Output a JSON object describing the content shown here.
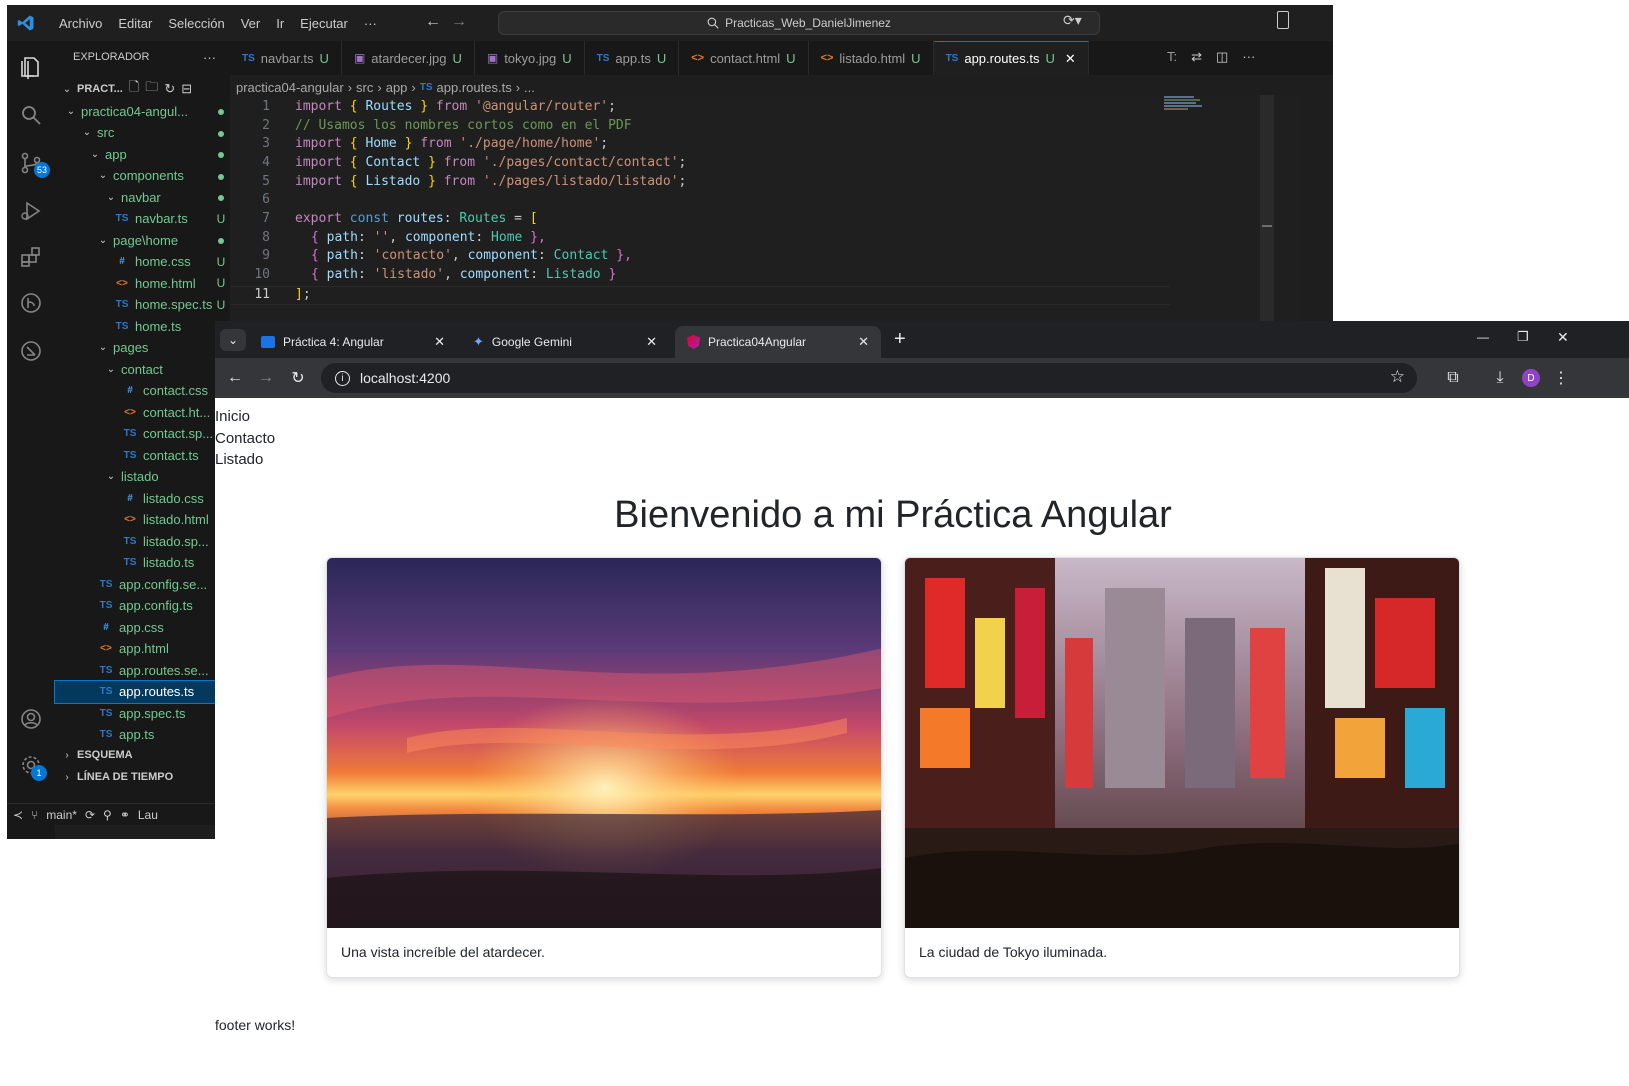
{
  "vscode": {
    "menu": [
      "Archivo",
      "Editar",
      "Selección",
      "Ver",
      "Ir",
      "Ejecutar",
      "···"
    ],
    "search_text": "Practicas_Web_DanielJimenez",
    "activity_badges": {
      "source_control": "53",
      "settings": "1"
    },
    "explorer": {
      "title": "EXPLORADOR",
      "more": "···",
      "root": "PRACT...",
      "tree": [
        {
          "label": "practica04-angul...",
          "status": "dot",
          "icon": ""
        },
        {
          "label": "src",
          "status": "dot",
          "icon": ""
        },
        {
          "label": "app",
          "status": "dot",
          "icon": ""
        },
        {
          "label": "components",
          "status": "dot",
          "icon": ""
        },
        {
          "label": "navbar",
          "status": "dot",
          "icon": ""
        },
        {
          "label": "navbar.ts",
          "status": "U",
          "icon": "TS"
        },
        {
          "label": "page\\home",
          "status": "dot",
          "icon": ""
        },
        {
          "label": "home.css",
          "status": "U",
          "icon": "#"
        },
        {
          "label": "home.html",
          "status": "U",
          "icon": "<>"
        },
        {
          "label": "home.spec.ts",
          "status": "U",
          "icon": "TS"
        },
        {
          "label": "home.ts",
          "status": "U",
          "icon": "TS"
        },
        {
          "label": "pages",
          "status": "dot",
          "icon": ""
        },
        {
          "label": "contact",
          "status": "dot",
          "icon": ""
        },
        {
          "label": "contact.css",
          "status": "U",
          "icon": "#"
        },
        {
          "label": "contact.ht...",
          "status": "U",
          "icon": "<>"
        },
        {
          "label": "contact.sp...",
          "status": "U",
          "icon": "TS"
        },
        {
          "label": "contact.ts",
          "status": "U",
          "icon": "TS"
        },
        {
          "label": "listado",
          "status": "dot",
          "icon": ""
        },
        {
          "label": "listado.css",
          "status": "U",
          "icon": "#"
        },
        {
          "label": "listado.html",
          "status": "U",
          "icon": "<>"
        },
        {
          "label": "listado.sp...",
          "status": "U",
          "icon": "TS"
        },
        {
          "label": "listado.ts",
          "status": "U",
          "icon": "TS"
        },
        {
          "label": "app.config.se...",
          "status": "U",
          "icon": "TS"
        },
        {
          "label": "app.config.ts",
          "status": "U",
          "icon": "TS"
        },
        {
          "label": "app.css",
          "status": "U",
          "icon": "#"
        },
        {
          "label": "app.html",
          "status": "U",
          "icon": "<>"
        },
        {
          "label": "app.routes.se...",
          "status": "U",
          "icon": "TS"
        },
        {
          "label": "app.routes.ts",
          "status": "U",
          "icon": "TS"
        },
        {
          "label": "app.spec.ts",
          "status": "U",
          "icon": "TS"
        },
        {
          "label": "app.ts",
          "status": "U",
          "icon": "TS"
        }
      ],
      "sections": [
        "ESQUEMA",
        "LÍNEA DE TIEMPO"
      ]
    },
    "statusbar": {
      "branch": "main*",
      "extra": "Lau"
    },
    "tabs": [
      {
        "label": "navbar.ts",
        "icon": "TS",
        "mod": "U"
      },
      {
        "label": "atardecer.jpg",
        "icon": "img",
        "mod": "U"
      },
      {
        "label": "tokyo.jpg",
        "icon": "img",
        "mod": "U"
      },
      {
        "label": "app.ts",
        "icon": "TS",
        "mod": "U"
      },
      {
        "label": "contact.html",
        "icon": "<>",
        "mod": "U"
      },
      {
        "label": "listado.html",
        "icon": "<>",
        "mod": "U"
      },
      {
        "label": "app.routes.ts",
        "icon": "TS",
        "mod": "U"
      }
    ],
    "tab_overflow": "T:",
    "breadcrumb": [
      "practica04-angular",
      "src",
      "app",
      "app.routes.ts",
      "..."
    ],
    "breadcrumb_icon": "TS",
    "code_lines": [
      "1",
      "2",
      "3",
      "4",
      "5",
      "6",
      "7",
      "8",
      "9",
      "10",
      "11"
    ],
    "code": {
      "l1": [
        "import",
        " { ",
        "Routes",
        " } ",
        "from",
        " '@angular/router'",
        ";"
      ],
      "l2": "// Usamos los nombres cortos como en el PDF",
      "l3": [
        "import",
        " { ",
        "Home",
        " } ",
        "from",
        " './page/home/home'",
        ";"
      ],
      "l4": [
        "import",
        " { ",
        "Contact",
        " } ",
        "from",
        " './pages/contact/contact'",
        ";"
      ],
      "l5": [
        "import",
        " { ",
        "Listado",
        " } ",
        "from",
        " './pages/listado/listado'",
        ";"
      ],
      "l7": [
        "export",
        " const",
        " routes",
        ": ",
        "Routes",
        " = ",
        "["
      ],
      "l8": [
        "{ ",
        "path",
        ": ",
        "''",
        ", ",
        "component",
        ": ",
        "Home",
        " },"
      ],
      "l9": [
        "{ ",
        "path",
        ": ",
        "'contacto'",
        ", ",
        "component",
        ": ",
        "Contact",
        " },"
      ],
      "l10": [
        "{ ",
        "path",
        ": ",
        "'listado'",
        ", ",
        "component",
        ": ",
        "Listado",
        " }"
      ],
      "l11": [
        "]",
        ";"
      ]
    }
  },
  "browser": {
    "tabs": [
      {
        "title": "Práctica 4: Angular",
        "close": "✕"
      },
      {
        "title": "Google Gemini",
        "close": "✕"
      },
      {
        "title": "Practica04Angular",
        "close": "✕"
      }
    ],
    "new_tab": "+",
    "url": "localhost:4200",
    "profile_initial": "D",
    "window_controls": [
      "—",
      "❐",
      "✕"
    ]
  },
  "page": {
    "nav": [
      "Inicio",
      "Contacto",
      "Listado"
    ],
    "title": "Bienvenido a mi Práctica Angular",
    "cards": [
      {
        "caption": "Una vista increíble del atardecer."
      },
      {
        "caption": "La ciudad de Tokyo iluminada."
      }
    ],
    "footer": "footer works!"
  }
}
